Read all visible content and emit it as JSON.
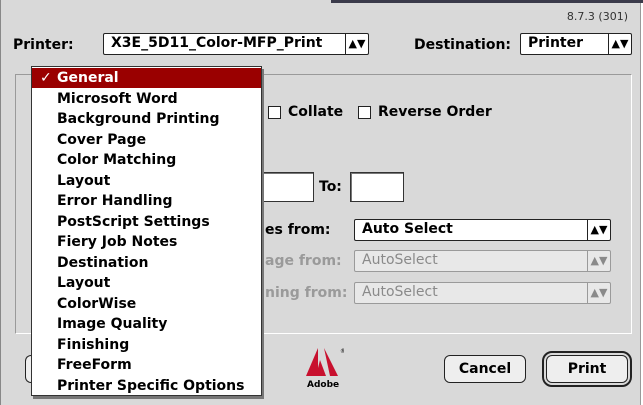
{
  "version": "8.7.3 (301)",
  "printer": {
    "label": "Printer:",
    "value": "X3E_5D11_Color-MFP_Print"
  },
  "destination": {
    "label": "Destination:",
    "value": "Printer"
  },
  "copies_options": {
    "collate": "Collate",
    "reverse_order": "Reverse Order"
  },
  "pages": {
    "to_label": "To:"
  },
  "paper_source": {
    "first_partial": "es from:",
    "first_value": "Auto Select",
    "remaining_partial": "age from:",
    "remaining_value": "AutoSelect",
    "third_partial": "ning from:",
    "third_value": "AutoSelect"
  },
  "menu": {
    "items": [
      "General",
      "Microsoft Word",
      "Background Printing",
      "Cover Page",
      "Color Matching",
      "Layout",
      "Error Handling",
      "PostScript Settings",
      "Fiery Job Notes",
      "Destination",
      "Layout",
      "ColorWise",
      "Image Quality",
      "Finishing",
      "FreeForm",
      "Printer Specific Options"
    ],
    "selected": "General",
    "check": "✓"
  },
  "buttons": {
    "cancel": "Cancel",
    "print": "Print"
  },
  "adobe_logo_text": "Adobe",
  "colors": {
    "menu_highlight": "#9a0000",
    "dialog_bg": "#d9d9d9"
  }
}
